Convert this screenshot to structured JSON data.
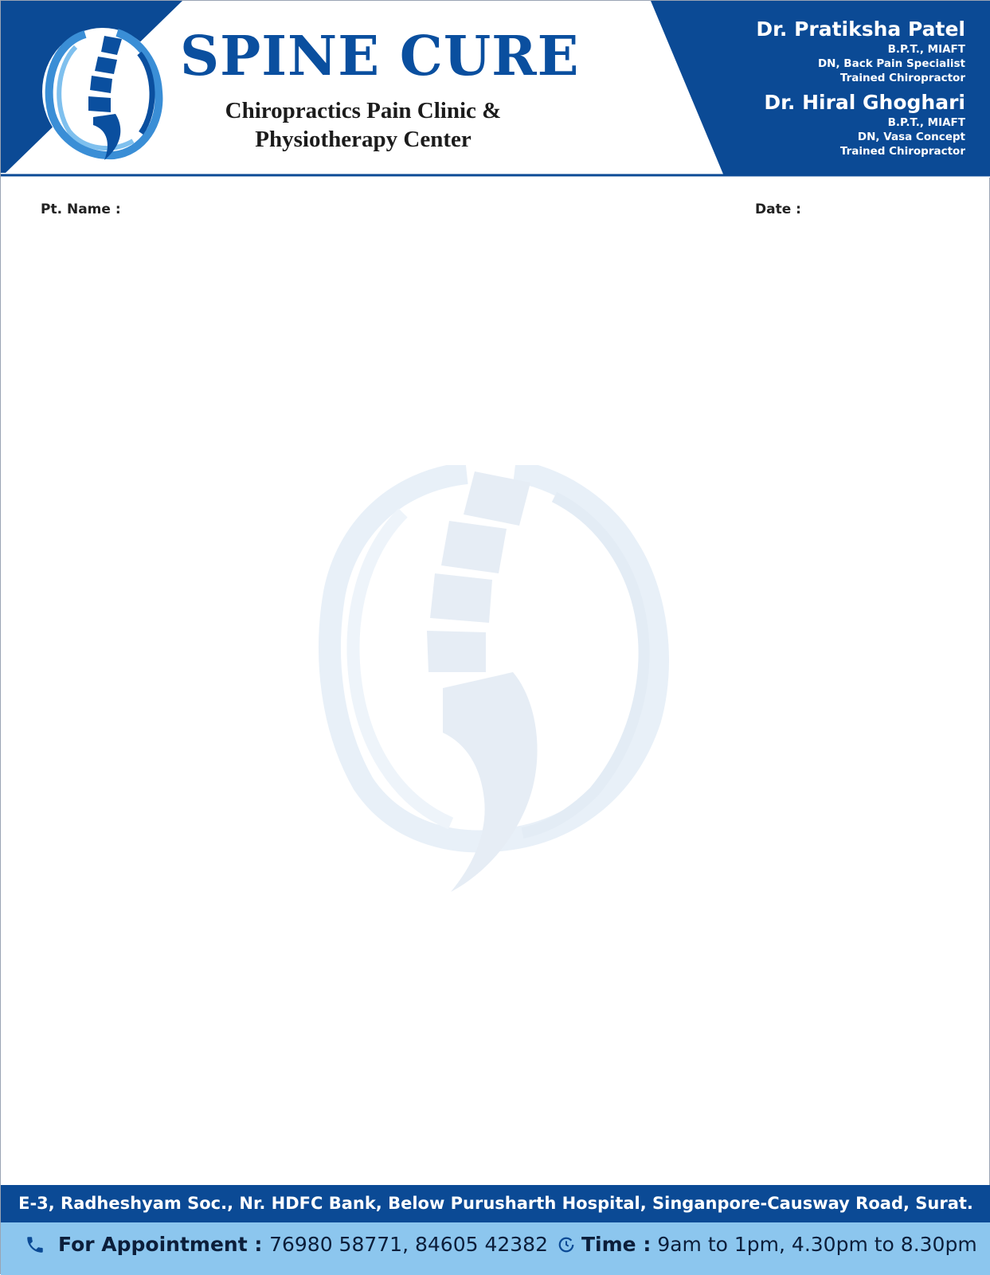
{
  "brand": {
    "name": "SPINE CURE",
    "tagline_line1": "Chiropractics Pain Clinic &",
    "tagline_line2": "Physiotherapy Center"
  },
  "doctors": [
    {
      "name": "Dr. Pratiksha Patel",
      "lines": [
        "B.P.T., MIAFT",
        "DN, Back Pain Specialist",
        "Trained Chiropractor"
      ]
    },
    {
      "name": "Dr. Hiral Ghoghari",
      "lines": [
        "B.P.T., MIAFT",
        "DN, Vasa Concept",
        "Trained Chiropractor"
      ]
    }
  ],
  "fields": {
    "patient_name_label": "Pt. Name :",
    "date_label": "Date :"
  },
  "footer": {
    "address": "E-3, Radheshyam Soc., Nr. HDFC Bank, Below Purusharth Hospital, Singanpore-Causway Road, Surat.",
    "appointment_label": "For Appointment",
    "appointment_separator": " : ",
    "phones": "76980 58771, 84605 42382",
    "time_label": "Time :",
    "time_value": "9am to 1pm, 4.30pm to 8.30pm"
  },
  "icons": {
    "logo": "spine-logo-icon",
    "phone": "phone-icon",
    "clock": "clock-icon",
    "watermark": "spine-watermark-icon"
  },
  "colors": {
    "brand_blue": "#0a4f9f",
    "header_blue": "#0b4a95",
    "light_blue": "#8cc6ee",
    "watermark": "#e6edf5"
  }
}
